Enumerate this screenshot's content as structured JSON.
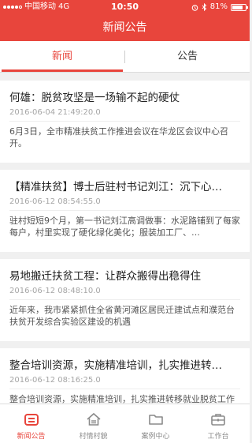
{
  "status_bar": {
    "carrier": "中国移动",
    "network": "4G",
    "time": "10:50",
    "battery": "81%",
    "battery_level": 0.81,
    "icons": [
      "signal-icon",
      "alarm-icon",
      "bluetooth-icon",
      "battery-icon"
    ]
  },
  "nav": {
    "title": "新闻公告"
  },
  "tabs": [
    {
      "label": "新闻",
      "active": true
    },
    {
      "label": "公告",
      "active": false
    }
  ],
  "news": [
    {
      "title": "何雄：脱贫攻坚是一场输不起的硬仗",
      "date": "2016-06-04 21:49:20.0",
      "summary": "6月3日，全市精准扶贫工作推进会议在华龙区会议中心召开。"
    },
    {
      "title": "【精准扶贫】博士后驻村书记刘江：沉下心…",
      "date": "2016-06-12 08:54:55.0",
      "summary": "驻村短短9个月，第一书记刘江高调做事：水泥路铺到了每家每户，村里实现了硬化绿化美化；服装加工厂、…"
    },
    {
      "title": "易地搬迁扶贫工程：让群众搬得出稳得住",
      "date": "2016-06-12 08:48:10.0",
      "summary": "近年来，我市紧紧抓住全省黄河滩区居民迁建试点和濮范台扶贫开发综合实验区建设的机遇"
    },
    {
      "title": "整合培训资源，实施精准培训，扎实推进转…",
      "date": "2016-06-12 08:16:25.0",
      "summary": "整合培训资源，实施精准培训，扎实推进转移就业脱贫工作"
    }
  ],
  "tabbar": [
    {
      "label": "新闻公告",
      "icon": "news-icon",
      "active": true
    },
    {
      "label": "村情村貌",
      "icon": "house-icon",
      "active": false
    },
    {
      "label": "案例中心",
      "icon": "folder-icon",
      "active": false
    },
    {
      "label": "工作台",
      "icon": "briefcase-icon",
      "active": false
    }
  ],
  "colors": {
    "accent": "#e8453c",
    "inactive": "#8a8a8a",
    "background": "#f0f0f0"
  }
}
